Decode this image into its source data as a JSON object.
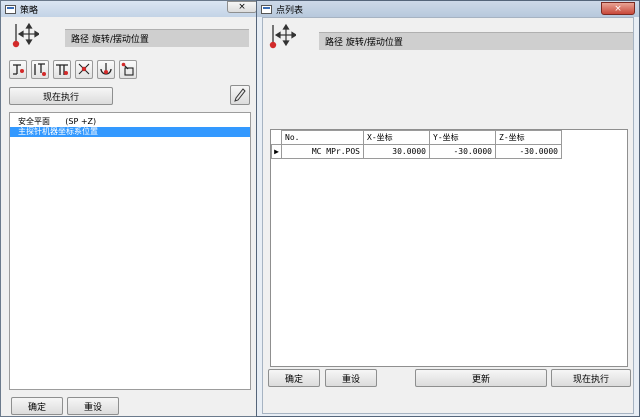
{
  "background": {
    "tabs": [
      "",
      "",
      "",
      ""
    ]
  },
  "strategy": {
    "title": "策略",
    "close_glyph": "×",
    "header": "路径  旋转/摆动位置",
    "tool_icons": [
      "tool-icon-1",
      "tool-icon-2",
      "tool-icon-3",
      "tool-icon-4",
      "tool-icon-5",
      "tool-icon-6"
    ],
    "execute_now": "现在执行",
    "items": [
      {
        "text": "安全平面      (SP +Z)",
        "selected": false
      },
      {
        "text": "主探针机器坐标系位置",
        "selected": true
      }
    ],
    "ok": "确定",
    "reset": "重设"
  },
  "pointlist": {
    "title": "点列表",
    "close_glyph": "×",
    "header": "路径  旋转/摆动位置",
    "columns": [
      "No.",
      "X-坐标",
      "Y-坐标",
      "Z-坐标"
    ],
    "rows": [
      {
        "marker": "▶",
        "name": "MC MPr.POS",
        "x": "30.0000",
        "y": "-30.0000",
        "z": "-30.0000"
      }
    ],
    "ok": "确定",
    "reset": "重设",
    "update": "更新",
    "execute_now": "现在执行"
  },
  "colors": {
    "selection": "#3399ff",
    "icon_red": "#d22a2a"
  }
}
